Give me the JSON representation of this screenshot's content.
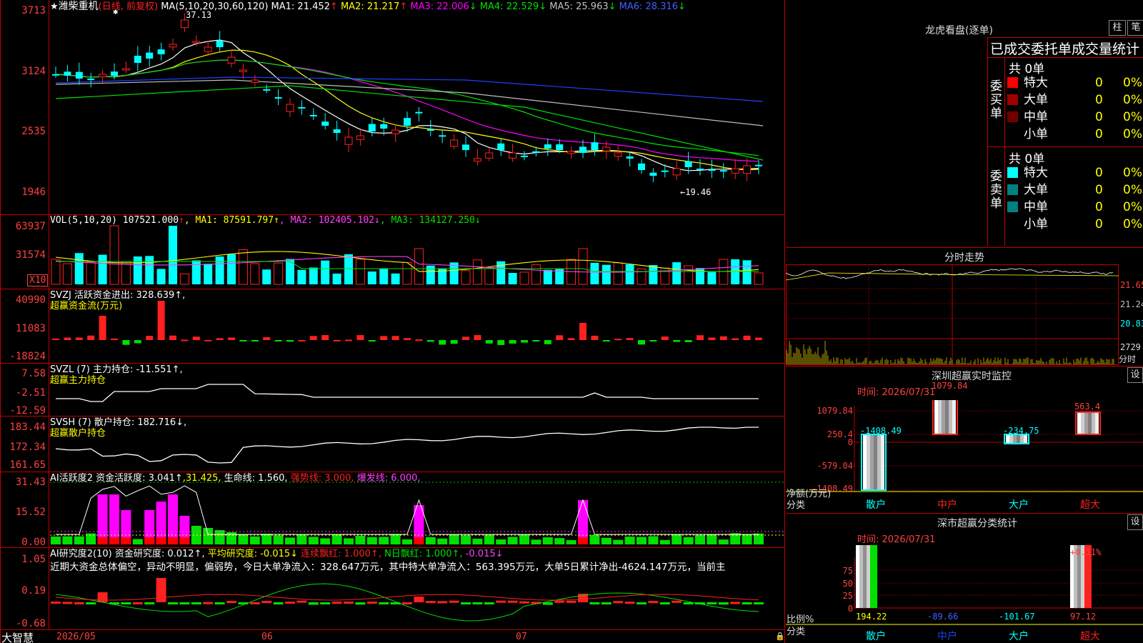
{
  "app": {
    "brand": "大智慧"
  },
  "stock": {
    "star": "★",
    "name": "潍柴重机",
    "period": "(日线, 前复权)",
    "ma_label": "MA(5,10,20,30,60,120)"
  },
  "main": {
    "ma": [
      {
        "label": "MA1:",
        "value": "21.452",
        "arrow": "↑",
        "color": "#ffffff"
      },
      {
        "label": "MA2:",
        "value": "21.217",
        "arrow": "↑",
        "color": "#ffff00"
      },
      {
        "label": "MA3:",
        "value": "22.006",
        "arrow": "↓",
        "color": "#ff00ff"
      },
      {
        "label": "MA4:",
        "value": "22.529",
        "arrow": "↓",
        "color": "#00e000"
      },
      {
        "label": "MA5:",
        "value": "25.963",
        "arrow": "↓",
        "color": "#c0c0c0"
      },
      {
        "label": "MA6:",
        "value": "28.316",
        "arrow": "↓",
        "color": "#4060ff"
      }
    ],
    "y_labels": [
      "3713",
      "3124",
      "2535",
      "1946"
    ],
    "high_note": "37.13",
    "low_note": "←19.46"
  },
  "vol": {
    "title": "VOL(5,10,20)",
    "value": "107521.000",
    "arrow": "↑",
    "ma": [
      {
        "t": "MA1: 87591.797↑",
        "c": "#ffff00"
      },
      {
        "t": "MA2: 102405.102↓",
        "c": "#ff40ff"
      },
      {
        "t": "MA3: 134127.250↓",
        "c": "#00e000"
      }
    ],
    "y_labels": [
      "63937",
      "31574"
    ],
    "unit": "X10"
  },
  "svzj": {
    "title": "SVZJ  活跃资金进出: 328.639↑,",
    "sub": "超赢资金流(万元)",
    "y_labels": [
      "40990",
      "11083",
      "-18824"
    ]
  },
  "svzl": {
    "title": "SVZL (7) 主力持仓: -11.551↑,",
    "sub": "超赢主力持仓",
    "y_labels": [
      "7.58",
      "-2.51",
      "-12.59"
    ]
  },
  "svsh": {
    "title": "SVSH (7) 散户持仓: 182.716↓,",
    "sub": "超赢散户持仓",
    "y_labels": [
      "183.44",
      "172.34",
      "161.65"
    ]
  },
  "ai1": {
    "title": "AI活跃度2 资金活跃度: 3.041↑",
    "v2": ",31.425,",
    "v3": "生命线: 1.560,",
    "v4": "强势线: 3.000,",
    "v5": "爆发线: 6.000,",
    "y_labels": [
      "31.43",
      "15.52",
      "0.00"
    ]
  },
  "ai2": {
    "title": "AI研究度2(10) 资金研究度: 0.012↑,",
    "v2": "平均研究度: -0.015↓",
    "v3": "连续飘红: 1.000↑,",
    "v4": "N日飘红: 1.000↑,",
    "v5": "-0.015↓",
    "desc": "近期大资金总体偏空，异动不明显，偏弱势，今日大单净流入：328.647万元，其中特大单净流入：563.395万元，大单5日累计净出-4624.147万元，当前主",
    "y_labels": [
      "1.05",
      "0.19",
      "-0.68"
    ]
  },
  "xaxis": [
    "2026/05",
    "06",
    "07"
  ],
  "right": {
    "lhb_title": "龙虎看盘(逐单)",
    "btn_bar": "柱",
    "btn_pen": "笔",
    "header": "已成交委托单成交量统计",
    "buy_label": "委买单",
    "sell_label": "委卖单",
    "buy_total": "共 0单",
    "sell_total": "共 0单",
    "buy_rows": [
      {
        "n": "特大",
        "v": "0",
        "p": "0%",
        "c": "#ff0000"
      },
      {
        "n": "大单",
        "v": "0",
        "p": "0%",
        "c": "#a00000"
      },
      {
        "n": "中单",
        "v": "0",
        "p": "0%",
        "c": "#700000"
      },
      {
        "n": "小单",
        "v": "0",
        "p": "0%",
        "c": "#000000"
      }
    ],
    "sell_rows": [
      {
        "n": "特大",
        "v": "0",
        "p": "0%",
        "c": "#00ffff"
      },
      {
        "n": "大单",
        "v": "0",
        "p": "0%",
        "c": "#008080"
      },
      {
        "n": "中单",
        "v": "0",
        "p": "0%",
        "c": "#008080"
      },
      {
        "n": "小单",
        "v": "0",
        "p": "0%",
        "c": "#000000"
      }
    ],
    "fs_title": "分时走势",
    "fs_y": [
      "21.65",
      "21.24",
      "20.83"
    ],
    "fs_vol": "2729",
    "fs_vol_unit": "分时",
    "mon_title": "深圳超赢实时监控",
    "mon_set": "设",
    "mon_time": "时间: 2026/07/31",
    "mon_y": [
      "1079.84",
      "250.4",
      "0",
      "-579.04",
      "-1408.49"
    ],
    "mon_unit": "净额(万元)",
    "mon_cat": "分类",
    "mon_bars": [
      {
        "name": "散户",
        "value": "-1408.49"
      },
      {
        "name": "中户",
        "value": "1079.84"
      },
      {
        "name": "大户",
        "value": "-234.75"
      },
      {
        "name": "超大",
        "value": "563.4"
      }
    ],
    "cls_title": "深市超赢分类统计",
    "cls_set": "设",
    "cls_time": "时间: 2026/07/31",
    "cls_y": [
      "75",
      "50",
      "25",
      "0"
    ],
    "cls_unit": "比例%",
    "cls_cat": "分类",
    "cls_top": "+0.11%",
    "cls_vals": [
      {
        "name": "散户",
        "value": "194.22"
      },
      {
        "name": "中户",
        "value": "-89.66"
      },
      {
        "name": "大户",
        "value": "-101.67"
      },
      {
        "name": "超大",
        "value": "97.12"
      }
    ]
  },
  "colors": {
    "up": "#ff2020",
    "down": "#00ffff",
    "grid": "#c00000",
    "label": "#ff4040"
  }
}
